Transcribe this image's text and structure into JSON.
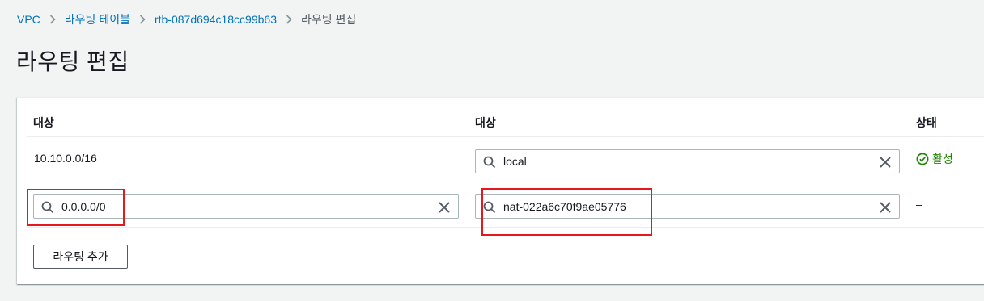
{
  "breadcrumb": {
    "items": [
      {
        "label": "VPC"
      },
      {
        "label": "라우팅 테이블"
      },
      {
        "label": "rtb-087d694c18cc99b63"
      },
      {
        "label": "라우팅 편집"
      }
    ]
  },
  "page": {
    "title": "라우팅 편집"
  },
  "routes_table": {
    "headers": {
      "destination": "대상",
      "target": "대상",
      "status": "상태"
    },
    "rows": [
      {
        "destination": "10.10.0.0/16",
        "target": "local",
        "status": "활성",
        "destination_editable": false
      },
      {
        "destination": "0.0.0.0/0",
        "target": "nat-022a6c70f9ae05776",
        "status": "–",
        "destination_editable": true
      }
    ]
  },
  "actions": {
    "add_route": "라우팅 추가"
  },
  "colors": {
    "link": "#0073bb",
    "status_active": "#1d8102",
    "highlight": "#e5191c"
  }
}
